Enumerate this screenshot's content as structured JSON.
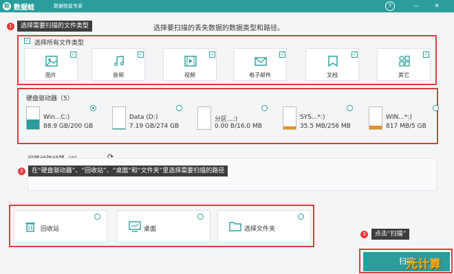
{
  "titlebar": {
    "app_name": "数据蛙",
    "app_subtitle": "数据恢复专家",
    "help": "?",
    "minimize": "—",
    "close": "✕"
  },
  "heading": "选择要扫描的丢失数据的数据类型和路径。",
  "callouts": [
    {
      "num": "1",
      "text": "选择需要扫描的文件类型"
    },
    {
      "num": "2",
      "text": "在“硬盘驱动器”、“回收站”、“桌面”和“文件夹”里选择需要扫描的路径"
    },
    {
      "num": "3",
      "text": "点击“扫描”"
    }
  ],
  "file_types": {
    "select_all_label": "选择所有文件类型",
    "items": [
      {
        "label": "图片",
        "icon": "image-icon"
      },
      {
        "label": "音频",
        "icon": "music-icon"
      },
      {
        "label": "视频",
        "icon": "video-icon"
      },
      {
        "label": "电子邮件",
        "icon": "email-icon"
      },
      {
        "label": "文档",
        "icon": "document-icon"
      },
      {
        "label": "其它",
        "icon": "other-icon"
      }
    ]
  },
  "hard_drives": {
    "title": "硬盘驱动器（5）",
    "items": [
      {
        "name": "Win...C:)",
        "size": "88.9 GB/200 GB",
        "fill": 0.44,
        "color": "#2a9d9c"
      },
      {
        "name": "Data (D:)",
        "size": "7.19 GB/274 GB",
        "fill": 0.03,
        "color": "#2a9d9c"
      },
      {
        "name": "分区...:)",
        "size": "0.00  B/16.0 MB",
        "fill": 0.0,
        "color": "#e8902a"
      },
      {
        "name": "SYS...*:)",
        "size": "35.5 MB/256 MB",
        "fill": 0.14,
        "color": "#e8902a"
      },
      {
        "name": "WIN...*:)",
        "size": "817 MB/5 GB",
        "fill": 0.16,
        "color": "#e8902a"
      }
    ]
  },
  "removable": {
    "title": "可移动驱动器（0）",
    "refresh": "⟳"
  },
  "locations": [
    {
      "label": "回收站",
      "icon": "recycle-bin-icon"
    },
    {
      "label": "桌面",
      "icon": "desktop-icon"
    },
    {
      "label": "选择文件夹",
      "icon": "folder-icon"
    }
  ],
  "scan_button": "扫描",
  "watermark": "元计算"
}
